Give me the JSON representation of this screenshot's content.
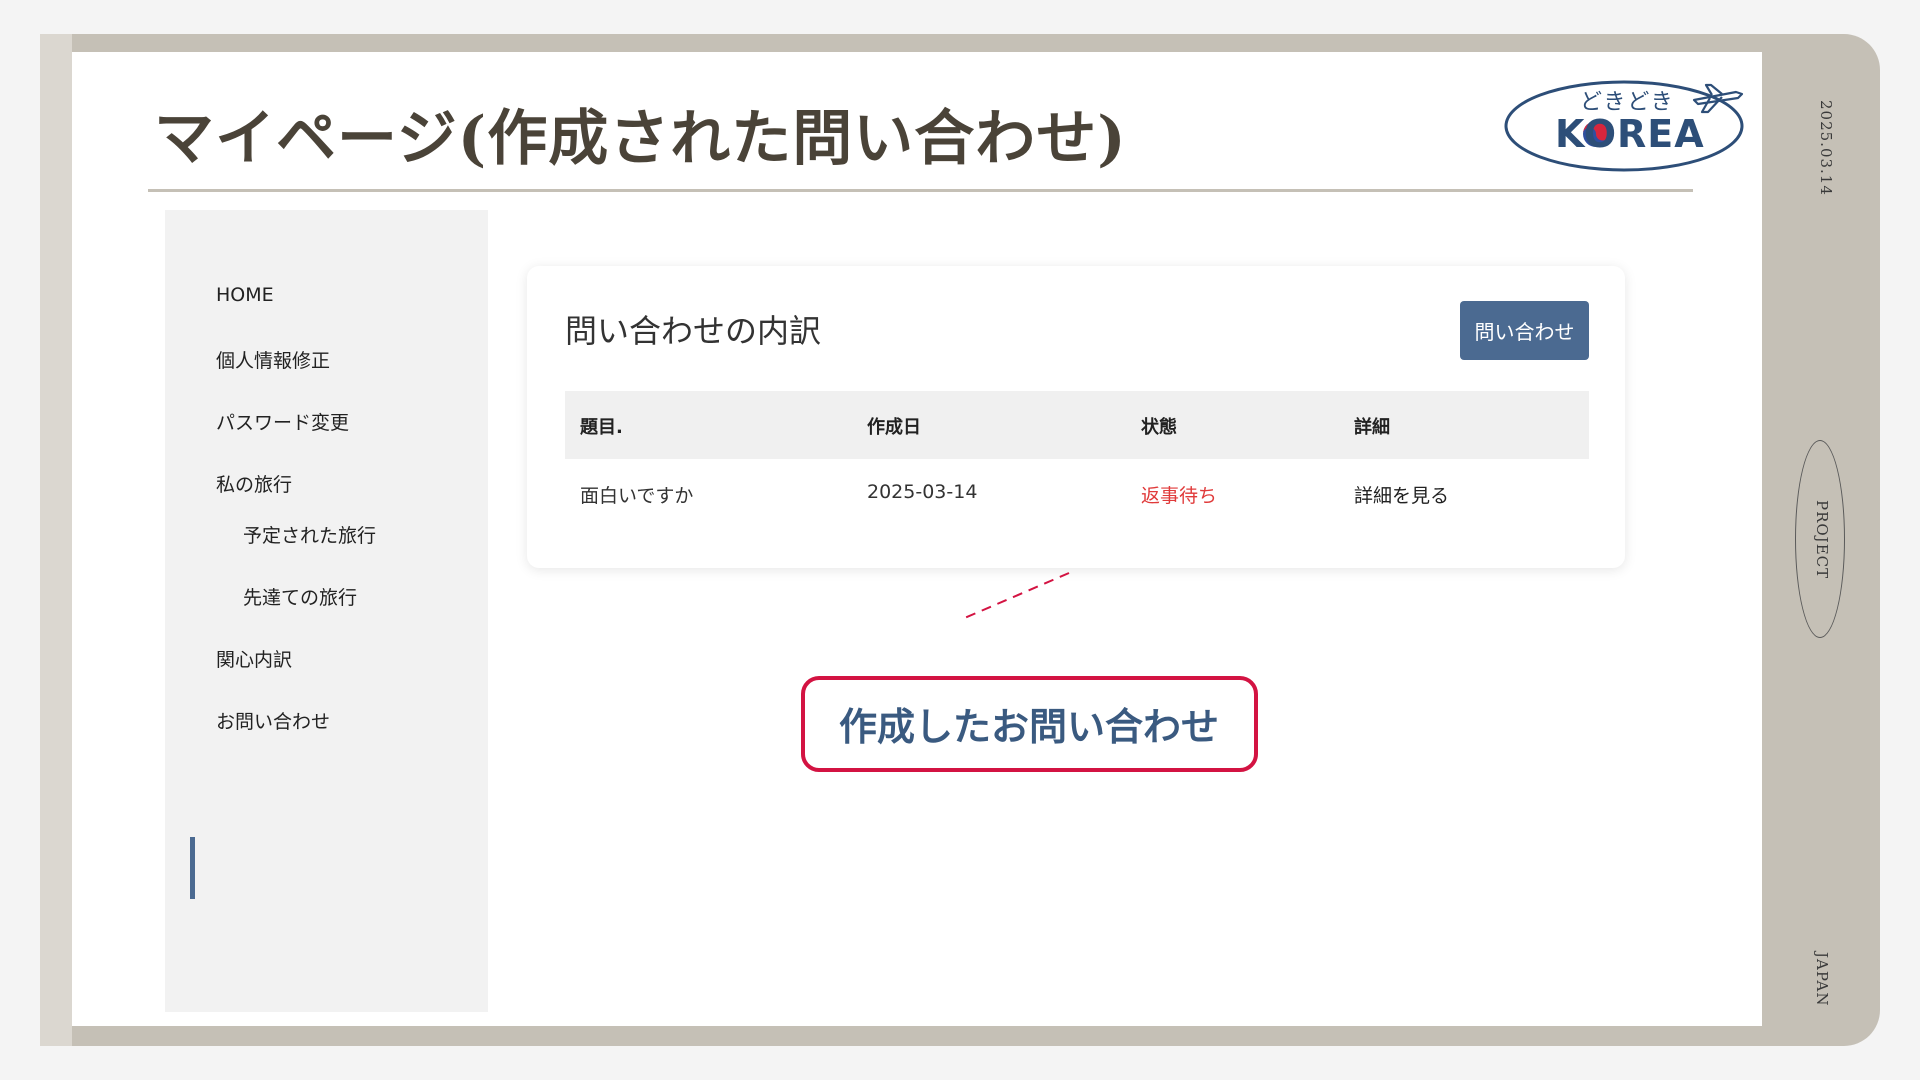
{
  "slide": {
    "title": "マイページ(作成された問い合わせ)",
    "logo": {
      "top_text": "どきどき",
      "main_text": "KOREA"
    },
    "side_labels": {
      "date": "2025.03.14",
      "project": "PROJECT",
      "japan": "JAPAN"
    }
  },
  "sidebar": {
    "items": [
      {
        "label": "HOME"
      },
      {
        "label": "個人情報修正"
      },
      {
        "label": "パスワード変更"
      },
      {
        "label": "私の旅行"
      },
      {
        "label": "予定された旅行"
      },
      {
        "label": "先達ての旅行"
      },
      {
        "label": "関心内訳"
      },
      {
        "label": "お問い合わせ"
      }
    ],
    "active_item": "お問い合わせ"
  },
  "card": {
    "title": "問い合わせの内訳",
    "button_label": "問い合わせ",
    "table": {
      "headers": [
        "題目.",
        "作成日",
        "状態",
        "詳細"
      ],
      "rows": [
        [
          "面白いですか",
          "2025-03-14",
          "返事待ち",
          "詳細を見る"
        ]
      ]
    }
  },
  "callout": {
    "text": "作成したお問い合わせ"
  },
  "colors": {
    "frame": "#c5c0b6",
    "accent": "#4b6a91",
    "status_pending": "#e03a3a",
    "callout_border": "#d31342",
    "title_text": "#4a4338"
  }
}
